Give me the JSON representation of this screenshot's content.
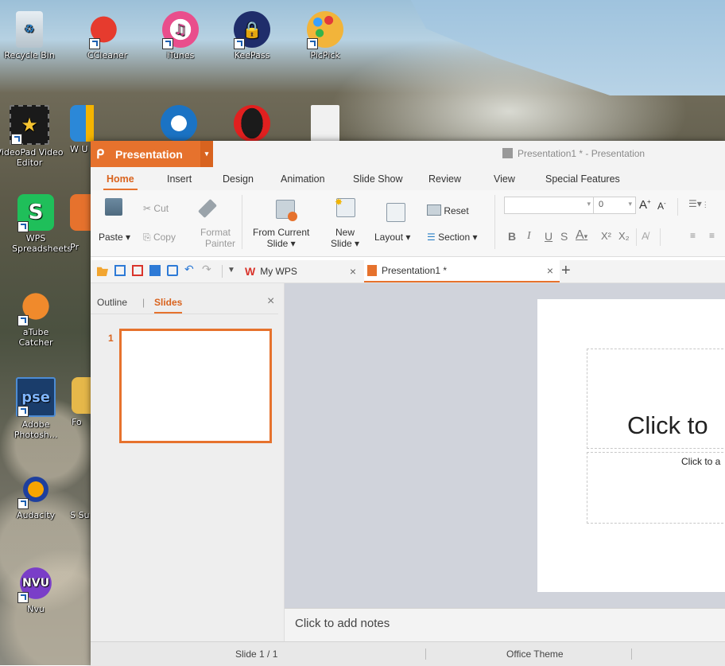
{
  "desktop": {
    "icons": [
      {
        "label": "Recycle Bin",
        "icon": "recycle-bin-icon"
      },
      {
        "label": "CCleaner",
        "icon": "ccleaner-icon"
      },
      {
        "label": "iTunes",
        "icon": "itunes-icon"
      },
      {
        "label": "KeePass",
        "icon": "keepass-icon"
      },
      {
        "label": "PicPick",
        "icon": "picpick-icon"
      },
      {
        "label": "VideoPad Video Editor",
        "icon": "videopad-icon"
      },
      {
        "label": "W U",
        "icon": "windows-update-icon"
      },
      {
        "label": "WPS Spreadsheets",
        "icon": "wps-spreadsheets-icon"
      },
      {
        "label": "Pr",
        "icon": "wps-presentation-icon"
      },
      {
        "label": "aTube Catcher",
        "icon": "atube-catcher-icon"
      },
      {
        "label": "Adobe Photosh...",
        "icon": "photoshop-elements-icon"
      },
      {
        "label": "Fo",
        "icon": "folder-icon"
      },
      {
        "label": "Audacity",
        "icon": "audacity-icon"
      },
      {
        "label": "S Su",
        "icon": "app-icon"
      },
      {
        "label": "Nvu",
        "icon": "nvu-icon"
      }
    ]
  },
  "window": {
    "app_button": "Presentation",
    "title": "Presentation1 * - Presentation",
    "accent": "#e6722d"
  },
  "ribbon_tabs": [
    "Home",
    "Insert",
    "Design",
    "Animation",
    "Slide Show",
    "Review",
    "View",
    "Special Features"
  ],
  "ribbon": {
    "paste": "Paste",
    "cut": "Cut",
    "copy": "Copy",
    "format_painter_1": "Format",
    "format_painter_2": "Painter",
    "from_current_1": "From Current",
    "from_current_2": "Slide",
    "new_slide_1": "New",
    "new_slide_2": "Slide",
    "layout": "Layout",
    "reset": "Reset",
    "section": "Section",
    "font_size": "0",
    "bold": "B",
    "italic": "I",
    "underline": "U",
    "strike": "S",
    "font_color": "A",
    "superscript": "X²",
    "subscript": "X₂",
    "grow": "A",
    "shrink": "A"
  },
  "doc_tabs": [
    {
      "label": "My WPS"
    },
    {
      "label": "Presentation1 *"
    }
  ],
  "left_pane": {
    "outline_tab": "Outline",
    "divider": "|",
    "slides_tab": "Slides",
    "slide_number": "1"
  },
  "slide": {
    "title_placeholder": "Click to",
    "subtitle_placeholder": "Click to a"
  },
  "notes_placeholder": "Click to add notes",
  "status": {
    "slide_counter": "Slide 1 / 1",
    "theme": "Office Theme"
  }
}
